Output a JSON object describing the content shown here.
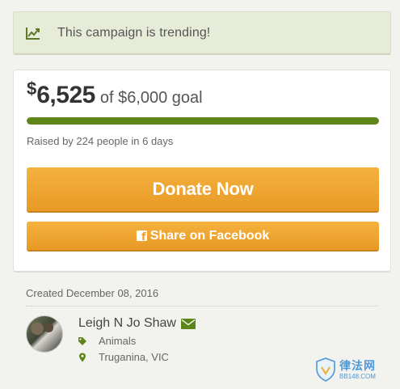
{
  "trend": {
    "icon": "trending-chart-icon",
    "text": "This campaign is trending!"
  },
  "campaign": {
    "currency": "$",
    "raised_amount": "6,525",
    "goal_text": "of $6,000 goal",
    "progress_fraction": 1.0,
    "raised_by": "Raised by 224 people in 6 days"
  },
  "buttons": {
    "donate": "Donate Now",
    "share": "Share on Facebook"
  },
  "created": "Created December 08, 2016",
  "organizer": {
    "name": "Leigh N Jo Shaw",
    "category": "Animals",
    "location": "Truganina, VIC"
  },
  "watermark": {
    "title": "律法网",
    "subtitle": "BB148.COM"
  },
  "colors": {
    "accent_green": "#5e8519",
    "button_orange": "#eea52f",
    "banner_bg": "#e6ecd8"
  }
}
